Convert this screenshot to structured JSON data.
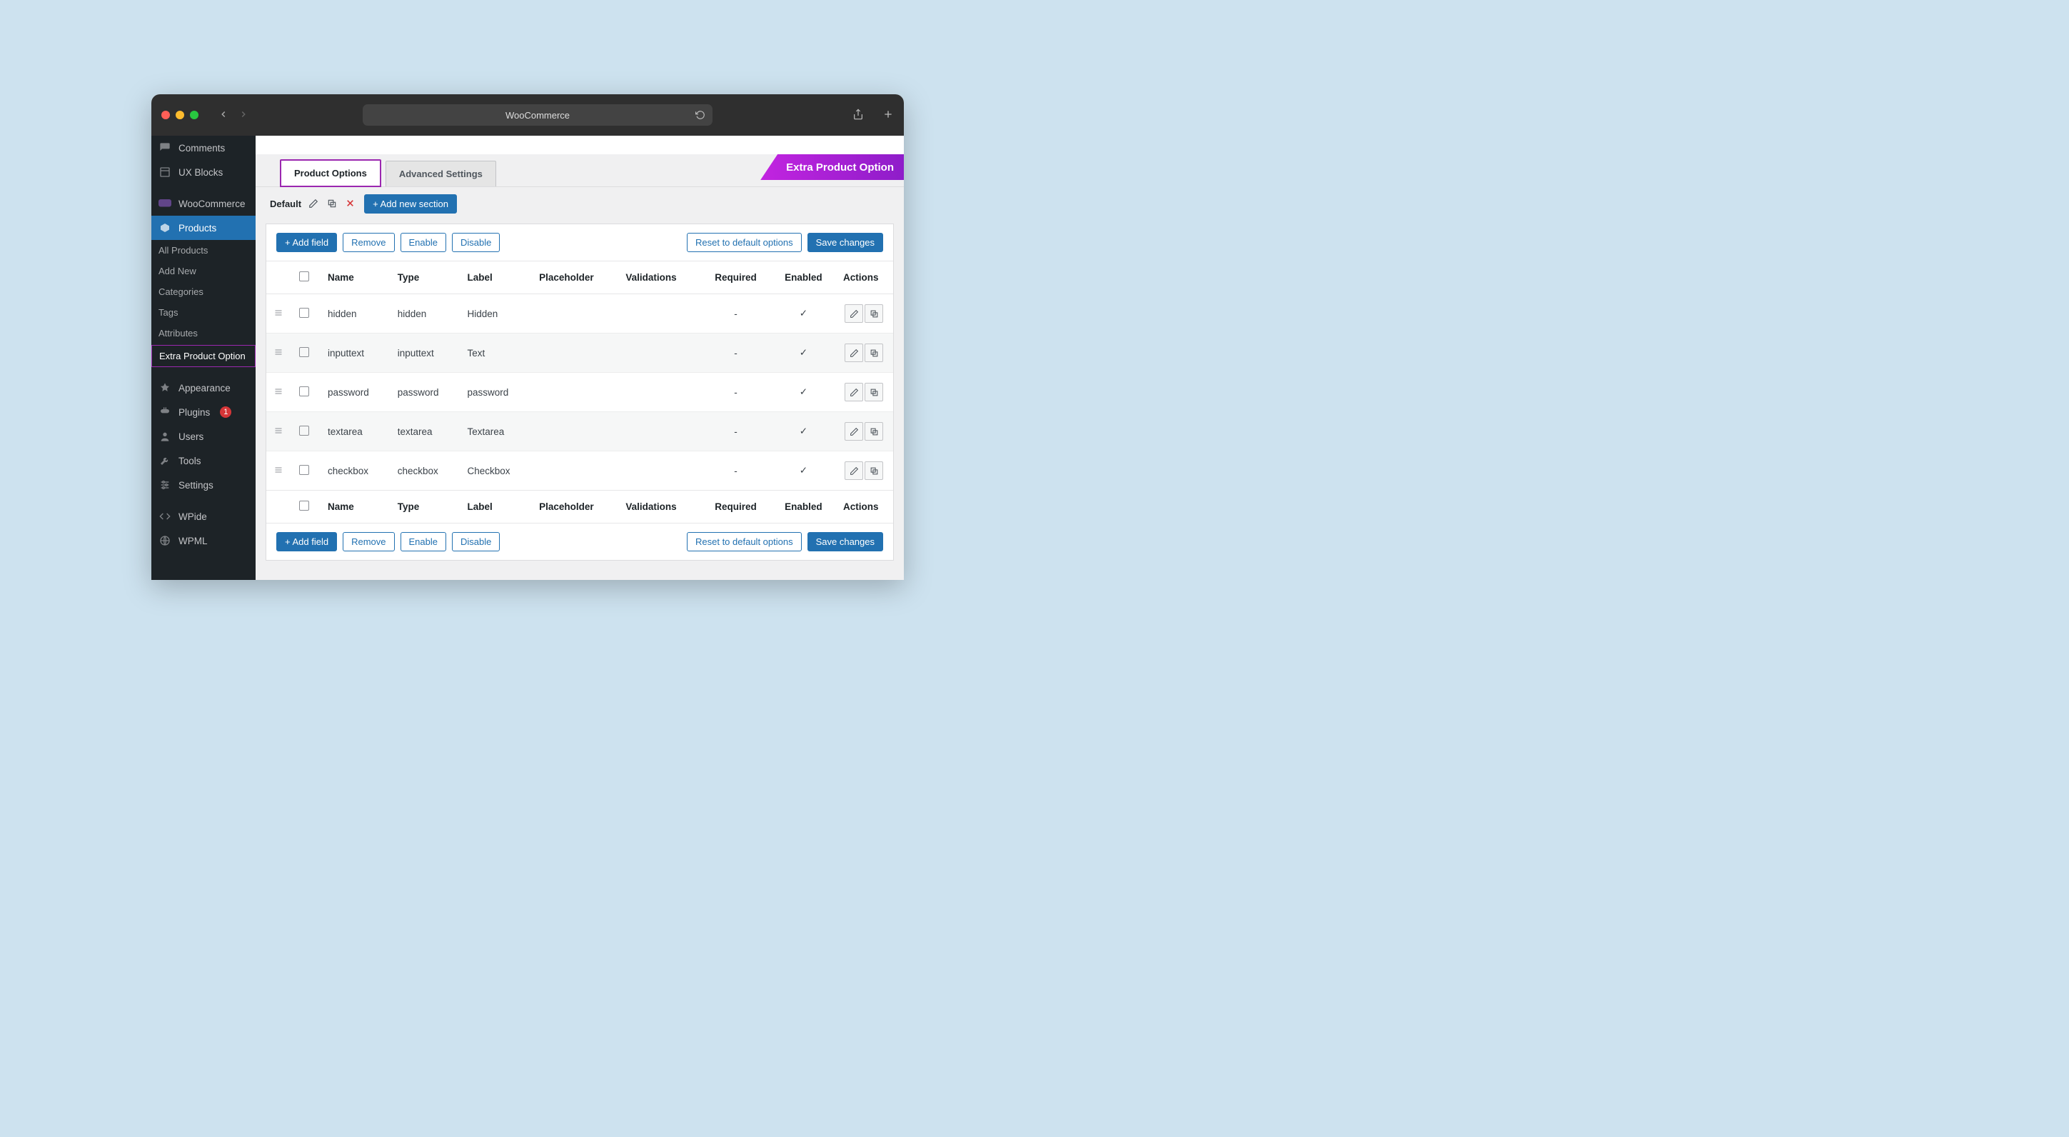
{
  "browser": {
    "title": "WooCommerce"
  },
  "sidebar": {
    "items": [
      {
        "icon": "comment",
        "label": "Comments"
      },
      {
        "icon": "block",
        "label": "UX Blocks"
      },
      {
        "icon": "woo",
        "label": "WooCommerce"
      },
      {
        "icon": "product",
        "label": "Products"
      },
      {
        "icon": "appearance",
        "label": "Appearance"
      },
      {
        "icon": "plugins",
        "label": "Plugins",
        "badge": "1"
      },
      {
        "icon": "users",
        "label": "Users"
      },
      {
        "icon": "tools",
        "label": "Tools"
      },
      {
        "icon": "settings",
        "label": "Settings"
      },
      {
        "icon": "wpide",
        "label": "WPide"
      },
      {
        "icon": "wpml",
        "label": "WPML"
      }
    ],
    "submenu": [
      "All Products",
      "Add New",
      "Categories",
      "Tags",
      "Attributes",
      "Extra Product Option"
    ]
  },
  "ribbon": "Extra Product Option",
  "tabs": {
    "active": "Product Options",
    "inactive": "Advanced Settings"
  },
  "section": {
    "label": "Default",
    "add_new": "+ Add new section"
  },
  "toolbar": {
    "add_field": "+ Add field",
    "remove": "Remove",
    "enable": "Enable",
    "disable": "Disable",
    "reset": "Reset to default options",
    "save": "Save changes"
  },
  "columns": {
    "name": "Name",
    "type": "Type",
    "label": "Label",
    "placeholder": "Placeholder",
    "validations": "Validations",
    "required": "Required",
    "enabled": "Enabled",
    "actions": "Actions"
  },
  "rows": [
    {
      "name": "hidden",
      "type": "hidden",
      "label": "Hidden",
      "required": "-",
      "enabled": "✓"
    },
    {
      "name": "inputtext",
      "type": "inputtext",
      "label": "Text",
      "required": "-",
      "enabled": "✓"
    },
    {
      "name": "password",
      "type": "password",
      "label": "password",
      "required": "-",
      "enabled": "✓"
    },
    {
      "name": "textarea",
      "type": "textarea",
      "label": "Textarea",
      "required": "-",
      "enabled": "✓"
    },
    {
      "name": "checkbox",
      "type": "checkbox",
      "label": "Checkbox",
      "required": "-",
      "enabled": "✓"
    }
  ]
}
